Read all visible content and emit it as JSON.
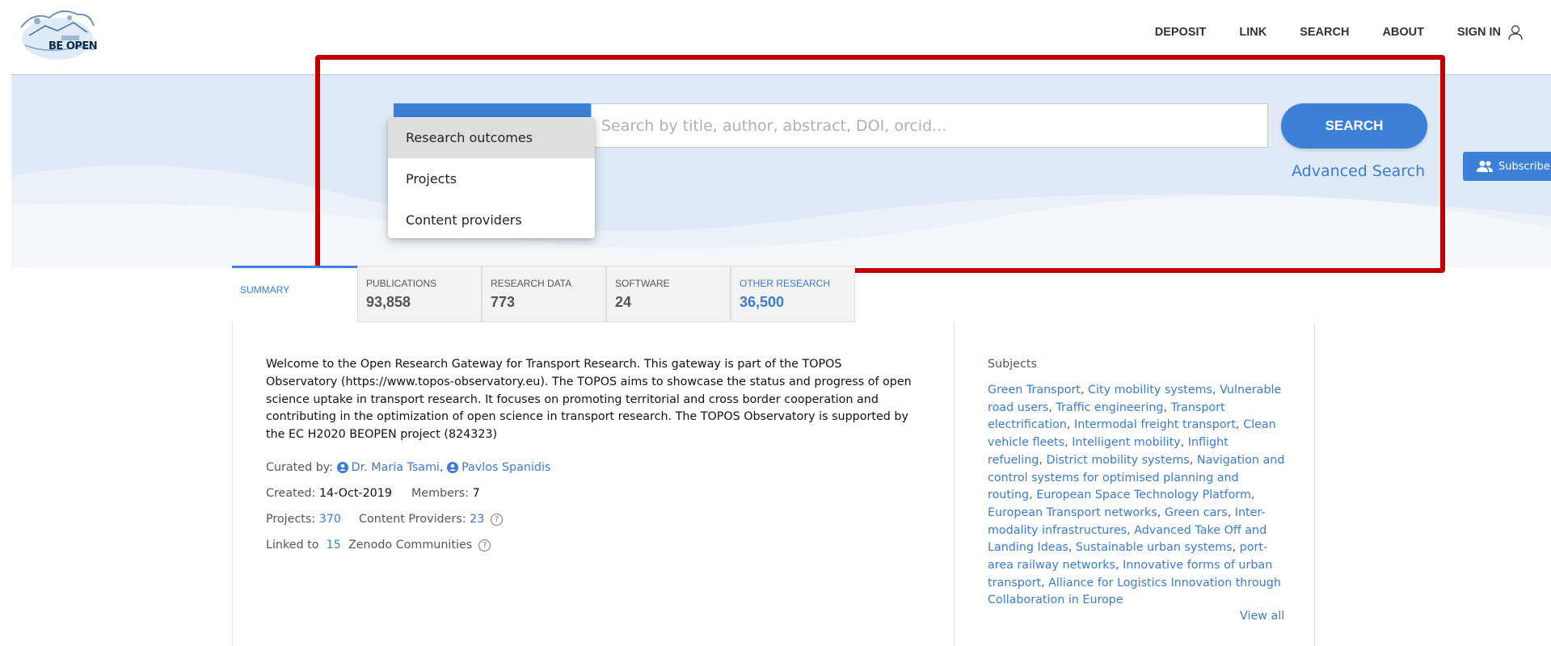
{
  "logo": {
    "text": "BE OPEN"
  },
  "nav": {
    "items": [
      {
        "label": "DEPOSIT"
      },
      {
        "label": "LINK"
      },
      {
        "label": "SEARCH"
      },
      {
        "label": "ABOUT"
      },
      {
        "label": "SIGN IN"
      }
    ]
  },
  "search": {
    "placeholder": "Search by title, author, abstract, DOI, orcid...",
    "button_label": "SEARCH",
    "advanced_label": "Advanced Search",
    "type_options": [
      {
        "label": "Research outcomes",
        "selected": true
      },
      {
        "label": "Projects",
        "selected": false
      },
      {
        "label": "Content providers",
        "selected": false
      }
    ]
  },
  "subscribe": {
    "label": "Subscribe"
  },
  "tabs": {
    "summary": {
      "label": "SUMMARY"
    },
    "publications": {
      "label": "PUBLICATIONS",
      "count": "93,858"
    },
    "research_data": {
      "label": "RESEARCH DATA",
      "count": "773"
    },
    "software": {
      "label": "SOFTWARE",
      "count": "24"
    },
    "other": {
      "label": "OTHER RESEARCH",
      "count": "36,500"
    }
  },
  "summary": {
    "description": "Welcome to the Open Research Gateway for Transport Research. This gateway is part of the TOPOS Observatory (https://www.topos-observatory.eu). The TOPOS aims to showcase the status and progress of open science uptake in transport research. It focuses on promoting territorial and cross border cooperation and contributing in the optimization of open science in transport research. The TOPOS Observatory is supported by the EC H2020 BEOPEN project (824323)",
    "curated_by_label": "Curated by:",
    "curators": [
      "Dr. Maria Tsami",
      "Pavlos Spanidis"
    ],
    "created_label": "Created:",
    "created_value": "14-Oct-2019",
    "members_label": "Members:",
    "members_value": "7",
    "projects_label": "Projects:",
    "projects_value": "370",
    "providers_label": "Content Providers:",
    "providers_value": "23",
    "linked_label": "Linked to",
    "linked_value": "15",
    "zenodo_label": "Zenodo Communities"
  },
  "subjects": {
    "title": "Subjects",
    "items": [
      "Green Transport",
      "City mobility systems",
      "Vulnerable road users",
      "Traffic engineering",
      "Transport electrification",
      "Intermodal freight transport",
      "Clean vehicle fleets",
      "Intelligent mobility",
      "Inflight refueling",
      "District mobility systems",
      "Navigation and control systems for optimised planning and routing",
      "European Space Technology Platform",
      "European Transport networks",
      "Green cars",
      "Inter-modality infrastructures",
      "Advanced Take Off and Landing Ideas",
      "Sustainable urban systems",
      "port-area railway networks",
      "Innovative forms of urban transport",
      "Alliance for Logistics Innovation through Collaboration in Europe"
    ],
    "view_all_label": "View all"
  },
  "colors": {
    "accent": "#3d80d8",
    "link": "#3a7bd5",
    "highlight": "#c00000",
    "hero_bg": "#dfeaf6"
  }
}
